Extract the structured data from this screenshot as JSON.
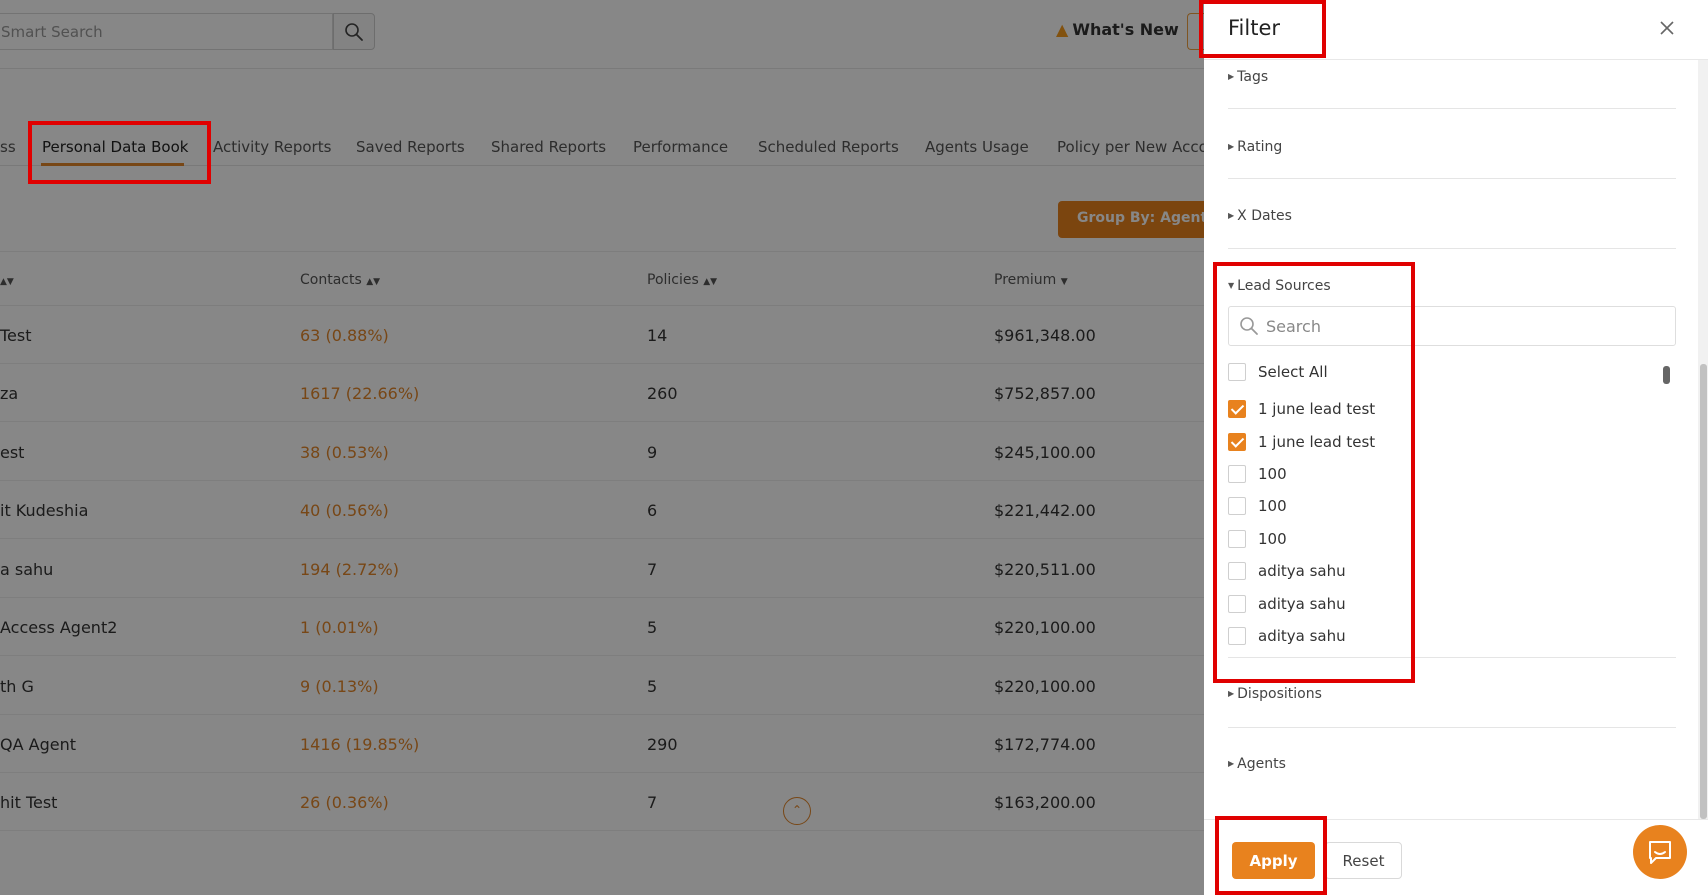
{
  "topbar": {
    "search_placeholder": "Smart Search",
    "whats_new": "What's New"
  },
  "tabs": [
    {
      "label": "ss"
    },
    {
      "label": "Personal Data Book",
      "active": true
    },
    {
      "label": "Activity Reports"
    },
    {
      "label": "Saved Reports"
    },
    {
      "label": "Shared Reports"
    },
    {
      "label": "Performance"
    },
    {
      "label": "Scheduled Reports"
    },
    {
      "label": "Agents Usage"
    },
    {
      "label": "Policy per New Acco"
    }
  ],
  "group_by_label": "Group By: Agents",
  "table": {
    "headers": {
      "contacts": "Contacts",
      "policies": "Policies",
      "premium": "Premium"
    },
    "rows": [
      {
        "name": "Test",
        "contacts": "63 (0.88%)",
        "policies": "14",
        "premium": "$961,348.00"
      },
      {
        "name": "za",
        "contacts": "1617 (22.66%)",
        "policies": "260",
        "premium": "$752,857.00"
      },
      {
        "name": "est",
        "contacts": "38 (0.53%)",
        "policies": "9",
        "premium": "$245,100.00"
      },
      {
        "name": "it Kudeshia",
        "contacts": "40 (0.56%)",
        "policies": "6",
        "premium": "$221,442.00"
      },
      {
        "name": "a sahu",
        "contacts": "194 (2.72%)",
        "policies": "7",
        "premium": "$220,511.00"
      },
      {
        "name": "Access Agent2",
        "contacts": "1 (0.01%)",
        "policies": "5",
        "premium": "$220,100.00"
      },
      {
        "name": "th G",
        "contacts": "9 (0.13%)",
        "policies": "5",
        "premium": "$220,100.00"
      },
      {
        "name": " QA Agent",
        "contacts": "1416 (19.85%)",
        "policies": "290",
        "premium": "$172,774.00"
      },
      {
        "name": "hit Test",
        "contacts": "26 (0.36%)",
        "policies": "7",
        "premium": "$163,200.00"
      }
    ]
  },
  "filter": {
    "title": "Filter",
    "sections": {
      "tags": "Tags",
      "rating": "Rating",
      "x_dates": "X Dates",
      "lead_sources": "Lead Sources",
      "dispositions": "Dispositions",
      "agents": "Agents"
    },
    "lead_search_placeholder": "Search",
    "options": [
      {
        "label": "Select All",
        "checked": false
      },
      {
        "label": "1 june lead test",
        "checked": true
      },
      {
        "label": "1 june lead test",
        "checked": true
      },
      {
        "label": "100",
        "checked": false
      },
      {
        "label": "100",
        "checked": false
      },
      {
        "label": "100",
        "checked": false
      },
      {
        "label": "aditya sahu",
        "checked": false
      },
      {
        "label": "aditya sahu",
        "checked": false
      },
      {
        "label": "aditya sahu",
        "checked": false
      }
    ],
    "apply_label": "Apply",
    "reset_label": "Reset"
  },
  "colors": {
    "accent": "#e8821e",
    "highlight": "#e00000",
    "overlay": "rgba(0,0,0,0.47)"
  },
  "icons": {
    "search": "search-icon",
    "close": "close-icon",
    "chat": "chat-icon",
    "flame": "flame-icon",
    "scroll_top": "chevrons-up-icon"
  }
}
